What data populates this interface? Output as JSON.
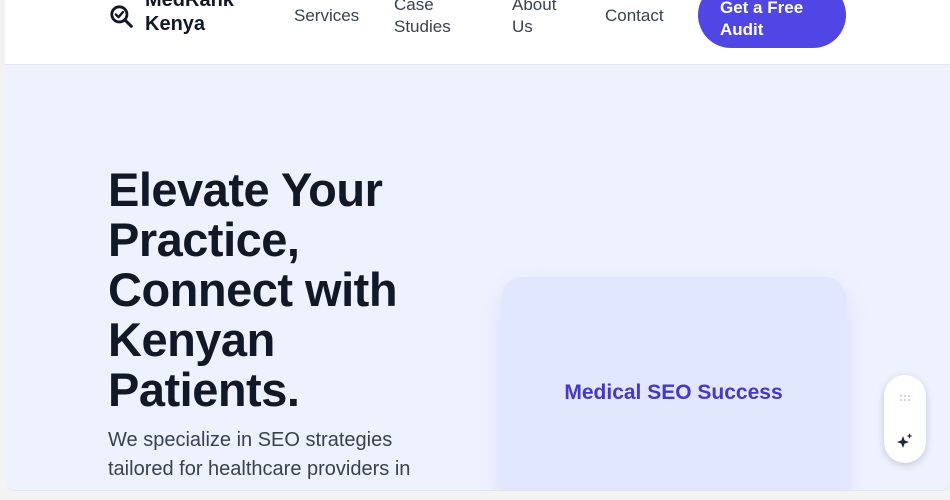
{
  "brand": {
    "name_line1": "MedRank",
    "name_line2": "Kenya"
  },
  "nav": {
    "services": "Services",
    "case_line1": "Case",
    "case_line2": "Studies",
    "about_line1": "About",
    "about_line2": "Us",
    "contact": "Contact",
    "cta_line1": "Get a Free",
    "cta_line2": "Audit"
  },
  "hero": {
    "title_lines": [
      "Elevate Your",
      "Practice,",
      "Connect with",
      "Kenyan",
      "Patients."
    ],
    "subtitle_lines": [
      "We specialize in SEO strategies",
      "tailored for healthcare providers in"
    ]
  },
  "card": {
    "title": "Medical SEO Success"
  },
  "icons": {
    "logo": "search-check-icon",
    "widget_top": "grip-dots-icon",
    "widget_bottom": "sparkle-icon"
  },
  "colors": {
    "brand": "#4f46e5",
    "heading": "#111827",
    "hero_bg": "#eef2ff",
    "card_bg": "#e0e7ff"
  }
}
